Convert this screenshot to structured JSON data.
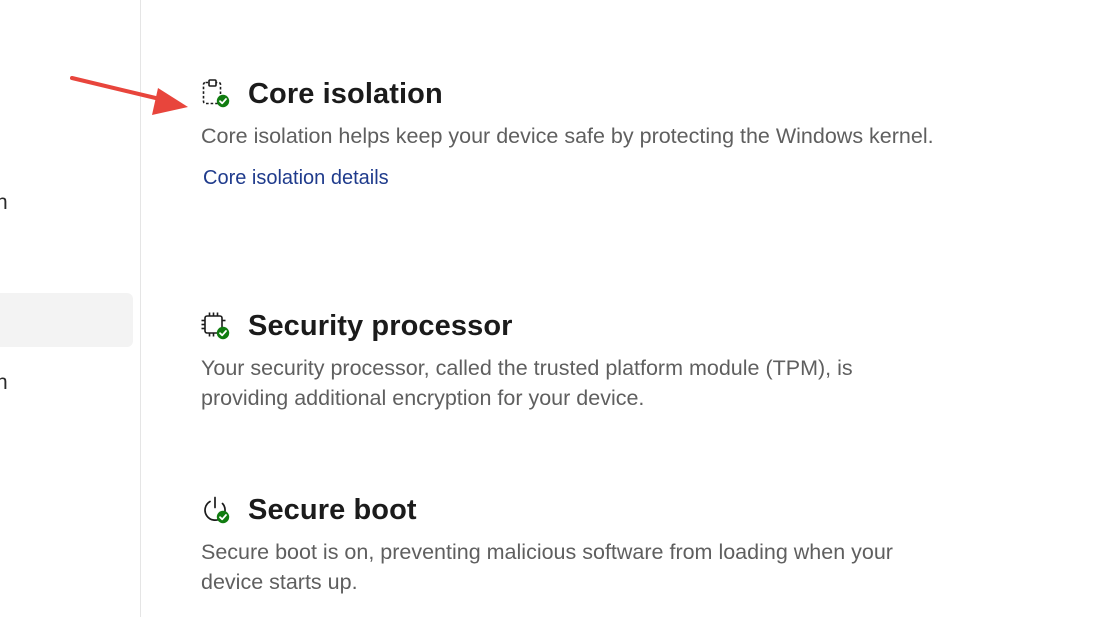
{
  "sidebar": {
    "partial_item_1": "n",
    "partial_item_2": "n"
  },
  "sections": [
    {
      "icon": "core-isolation-icon",
      "title": "Core isolation",
      "description": "Core isolation helps keep your device safe by protecting the Windows kernel.",
      "link": "Core isolation details"
    },
    {
      "icon": "security-processor-icon",
      "title": "Security processor",
      "description": "Your security processor, called the trusted platform module (TPM), is providing additional encryption for your device."
    },
    {
      "icon": "secure-boot-icon",
      "title": "Secure boot",
      "description": "Secure boot is on, preventing malicious software from loading when your device starts up."
    }
  ],
  "colors": {
    "status_ok": "#107c10",
    "link": "#1f3b8c",
    "annotation_arrow": "#e8453c"
  }
}
